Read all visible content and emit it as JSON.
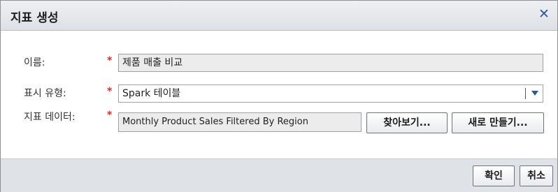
{
  "dialog": {
    "title": "지표 생성",
    "close_icon": "close-icon"
  },
  "form": {
    "name": {
      "label": "이름:",
      "required": "*",
      "value": "제품 매출 비교"
    },
    "display_type": {
      "label": "표시 유형:",
      "required": "*",
      "value": "Spark 테이블"
    },
    "indicator_data": {
      "label": "지표 데이터:",
      "required": "*",
      "value": "Monthly Product Sales Filtered By Region",
      "browse_label": "찾아보기...",
      "new_label": "새로 만들기..."
    }
  },
  "footer": {
    "ok_label": "확인",
    "cancel_label": "취소"
  },
  "colors": {
    "required": "#d9312a",
    "accent": "#2b5a9b",
    "footer_bg": "#dfe2e7"
  }
}
